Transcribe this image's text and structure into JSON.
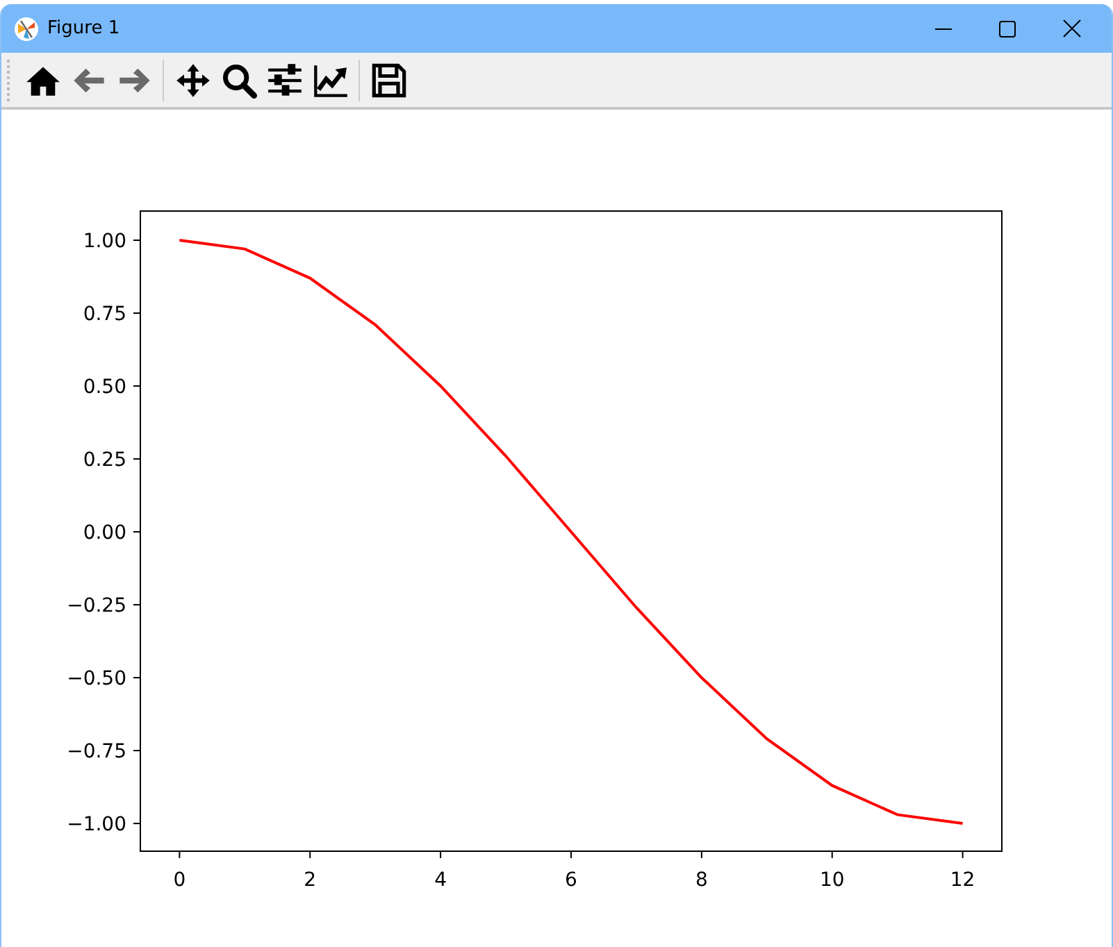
{
  "window": {
    "title": "Figure 1"
  },
  "toolbar": {
    "groups": [
      [
        {
          "kind": "home",
          "disabled": false
        },
        {
          "kind": "back",
          "disabled": true
        },
        {
          "kind": "forward",
          "disabled": true
        }
      ],
      [
        {
          "kind": "pan",
          "disabled": false
        },
        {
          "kind": "zoom",
          "disabled": false
        },
        {
          "kind": "configure",
          "disabled": false
        },
        {
          "kind": "edit",
          "disabled": false
        }
      ],
      [
        {
          "kind": "save",
          "disabled": false
        }
      ]
    ]
  },
  "plot": {
    "chart_data": {
      "type": "line",
      "x": [
        0,
        1,
        2,
        3,
        4,
        5,
        6,
        7,
        8,
        9,
        10,
        11,
        12
      ],
      "series": [
        {
          "color": "#ff0000",
          "values": [
            1,
            0.97,
            0.87,
            0.71,
            0.5,
            0.26,
            0,
            -0.26,
            -0.5,
            -0.71,
            -0.87,
            -0.97,
            -1
          ]
        }
      ],
      "xlim": [
        -0.6,
        12.6
      ],
      "ylim": [
        -1.095,
        1.1
      ],
      "xticks": [
        {
          "value": 0,
          "label": "0"
        },
        {
          "value": 2,
          "label": "2"
        },
        {
          "value": 4,
          "label": "4"
        },
        {
          "value": 6,
          "label": "6"
        },
        {
          "value": 8,
          "label": "8"
        },
        {
          "value": 10,
          "label": "10"
        },
        {
          "value": 12,
          "label": "12"
        }
      ],
      "yticks": [
        {
          "value": 1,
          "label": "1.00"
        },
        {
          "value": 0.75,
          "label": "0.75"
        },
        {
          "value": 0.5,
          "label": "0.50"
        },
        {
          "value": 0.25,
          "label": "0.25"
        },
        {
          "value": 0,
          "label": "0.00"
        },
        {
          "value": -0.25,
          "label": "−0.25"
        },
        {
          "value": -0.5,
          "label": "−0.50"
        },
        {
          "value": -0.75,
          "label": "−0.75"
        },
        {
          "value": -1,
          "label": "−1.00"
        }
      ]
    }
  }
}
